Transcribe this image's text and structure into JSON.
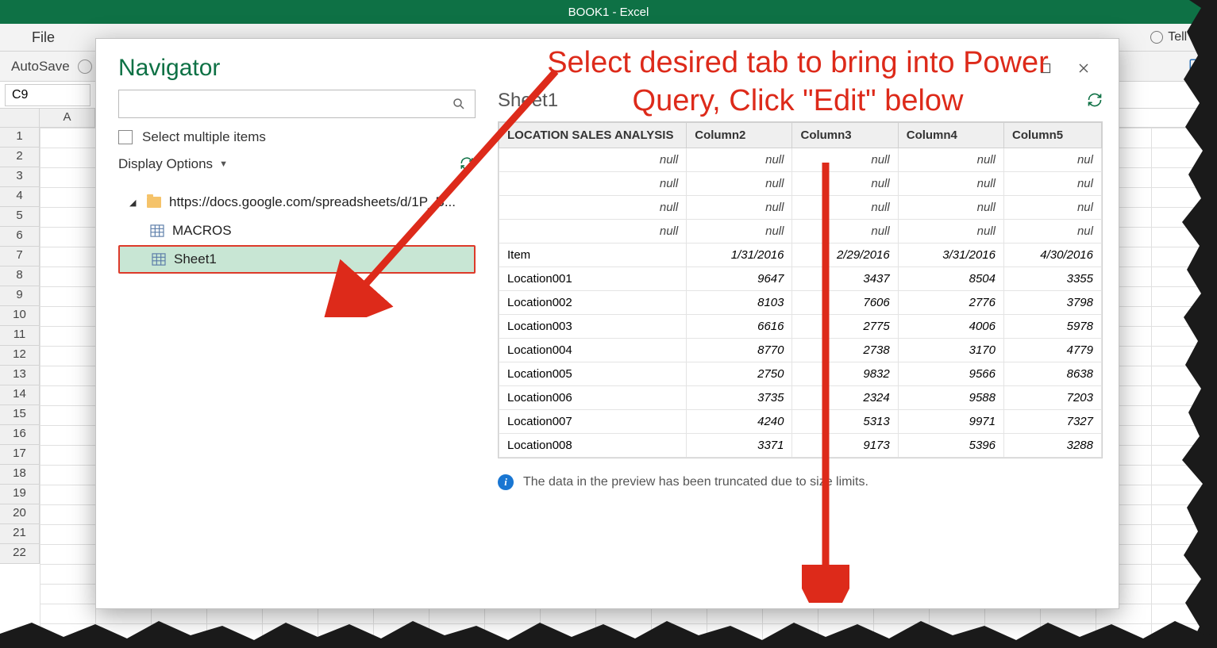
{
  "window": {
    "title": "BOOK1  -  Excel"
  },
  "ribbon": {
    "file": "File",
    "tellMe": "Tell m"
  },
  "toolbar": {
    "autosave": "AutoSave"
  },
  "sheet": {
    "nameBox": "C9",
    "colHeaders": [
      "A"
    ]
  },
  "rowNumbers": [
    "1",
    "2",
    "3",
    "4",
    "5",
    "6",
    "7",
    "8",
    "9",
    "10",
    "11",
    "12",
    "13",
    "14",
    "15",
    "16",
    "17",
    "18",
    "19",
    "20",
    "21",
    "22"
  ],
  "navigator": {
    "title": "Navigator",
    "searchPlaceholder": "",
    "selectMultiple": "Select multiple items",
    "displayOptions": "Display Options",
    "tree": {
      "root": "https://docs.google.com/spreadsheets/d/1P_B...",
      "items": [
        "MACROS",
        "Sheet1"
      ]
    },
    "preview": {
      "title": "Sheet1",
      "columns": [
        "LOCATION SALES ANALYSIS",
        "Column2",
        "Column3",
        "Column4",
        "Column5"
      ],
      "rows": [
        {
          "c1": "null",
          "c2": "null",
          "c3": "null",
          "c4": "null",
          "c5": "nul",
          "nullRow": true
        },
        {
          "c1": "null",
          "c2": "null",
          "c3": "null",
          "c4": "null",
          "c5": "nul",
          "nullRow": true
        },
        {
          "c1": "null",
          "c2": "null",
          "c3": "null",
          "c4": "null",
          "c5": "nul",
          "nullRow": true
        },
        {
          "c1": "null",
          "c2": "null",
          "c3": "null",
          "c4": "null",
          "c5": "nul",
          "nullRow": true
        },
        {
          "c1": "Item",
          "c2": "1/31/2016",
          "c3": "2/29/2016",
          "c4": "3/31/2016",
          "c5": "4/30/2016"
        },
        {
          "c1": "Location001",
          "c2": "9647",
          "c3": "3437",
          "c4": "8504",
          "c5": "3355"
        },
        {
          "c1": "Location002",
          "c2": "8103",
          "c3": "7606",
          "c4": "2776",
          "c5": "3798"
        },
        {
          "c1": "Location003",
          "c2": "6616",
          "c3": "2775",
          "c4": "4006",
          "c5": "5978"
        },
        {
          "c1": "Location004",
          "c2": "8770",
          "c3": "2738",
          "c4": "3170",
          "c5": "4779"
        },
        {
          "c1": "Location005",
          "c2": "2750",
          "c3": "9832",
          "c4": "9566",
          "c5": "8638"
        },
        {
          "c1": "Location006",
          "c2": "3735",
          "c3": "2324",
          "c4": "9588",
          "c5": "7203"
        },
        {
          "c1": "Location007",
          "c2": "4240",
          "c3": "5313",
          "c4": "9971",
          "c5": "7327"
        },
        {
          "c1": "Location008",
          "c2": "3371",
          "c3": "9173",
          "c4": "5396",
          "c5": "3288"
        }
      ],
      "infoMessage": "The data in the preview has been truncated due to size limits."
    }
  },
  "annotation": {
    "text": "Select desired tab to bring into Power Query, Click \"Edit\" below"
  }
}
